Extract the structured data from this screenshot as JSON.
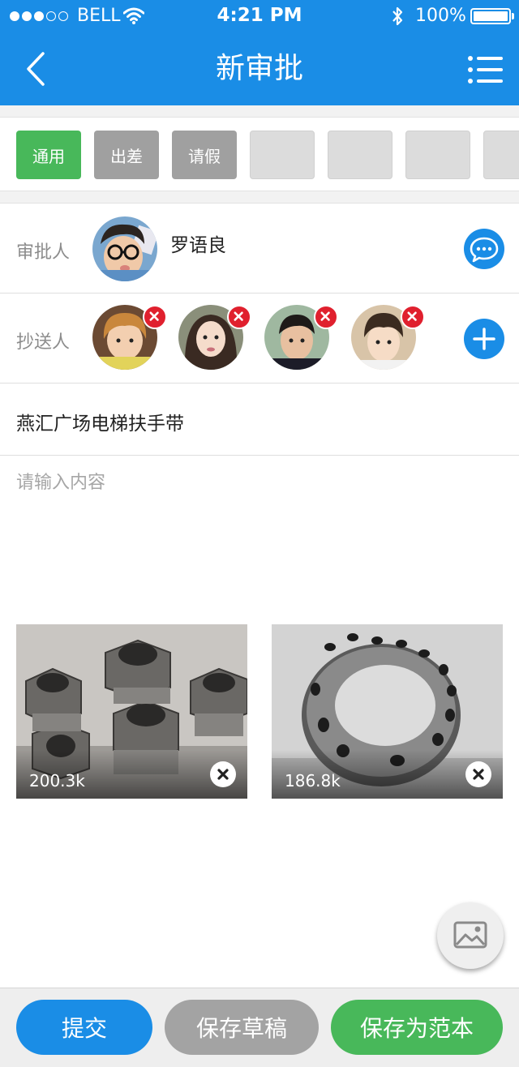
{
  "status_bar": {
    "carrier": "BELL",
    "time": "4:21 PM",
    "battery": "100%",
    "icons": [
      "signal-dots-icon",
      "wifi-icon",
      "bluetooth-icon",
      "battery-icon"
    ]
  },
  "nav": {
    "title": "新审批",
    "back_icon": "chevron-left-icon",
    "menu_icon": "list-menu-icon"
  },
  "tabs": [
    {
      "label": "通用",
      "state": "selected",
      "color": "#48b85a"
    },
    {
      "label": "出差",
      "state": "normal",
      "color": "#a0a0a0"
    },
    {
      "label": "请假",
      "state": "normal",
      "color": "#a0a0a0"
    },
    {
      "label": "",
      "state": "empty"
    },
    {
      "label": "",
      "state": "empty"
    },
    {
      "label": "",
      "state": "empty"
    },
    {
      "label": "",
      "state": "empty"
    }
  ],
  "approver": {
    "label": "审批人",
    "name": "罗语良",
    "message_icon": "chat-bubble-icon"
  },
  "cc": {
    "label": "抄送人",
    "people_count": 4,
    "remove_icon": "close-icon",
    "add_icon": "plus-icon"
  },
  "subject": "燕汇广场电梯扶手带",
  "content": {
    "placeholder": "请输入内容",
    "value": ""
  },
  "attachments": [
    {
      "size": "200.3k",
      "subject": "hex fittings photo"
    },
    {
      "size": "186.8k",
      "subject": "metal ring photo"
    }
  ],
  "image_button_icon": "image-icon",
  "actions": {
    "submit": "提交",
    "save_draft": "保存草稿",
    "save_template": "保存为范本"
  },
  "colors": {
    "primary": "#1a8de6",
    "green": "#48b85a",
    "gray": "#a3a3a3",
    "danger": "#e0202e"
  }
}
